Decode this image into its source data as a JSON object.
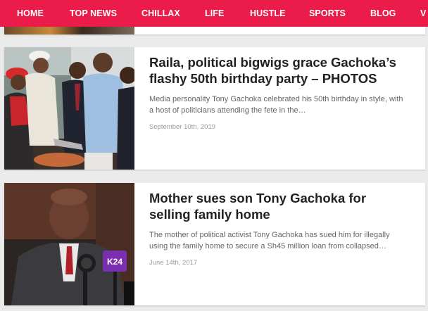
{
  "nav": {
    "items": [
      {
        "label": "HOME"
      },
      {
        "label": "TOP NEWS"
      },
      {
        "label": "CHILLAX"
      },
      {
        "label": "LIFE"
      },
      {
        "label": "HUSTLE"
      },
      {
        "label": "SPORTS"
      },
      {
        "label": "BLOG"
      },
      {
        "label": "V"
      }
    ],
    "background": "#ec1c4a"
  },
  "articles": [
    {
      "title": "Raila, political bigwigs grace Gachoka’s flashy 50th birthday party – PHOTOS",
      "excerpt": "Media personality Tony Gachoka celebrated his 50th birthday in style, with a host of politicians attending the fete in the…",
      "date": "September 10th, 2019",
      "image_icon": "party-photo"
    },
    {
      "title": "Mother sues son Tony Gachoka for selling family home",
      "excerpt": "The mother of political activist Tony Gachoka has sued him for illegally using the family home to secure a Sh45 million loan from collapsed…",
      "date": "June 14th, 2017",
      "image_icon": "press-conference-photo",
      "mic_logo_text": "K24"
    }
  ],
  "colors": {
    "title": "#222222",
    "excerpt": "#666666",
    "date": "#9a9a9a",
    "page_bg": "#ebebeb"
  }
}
